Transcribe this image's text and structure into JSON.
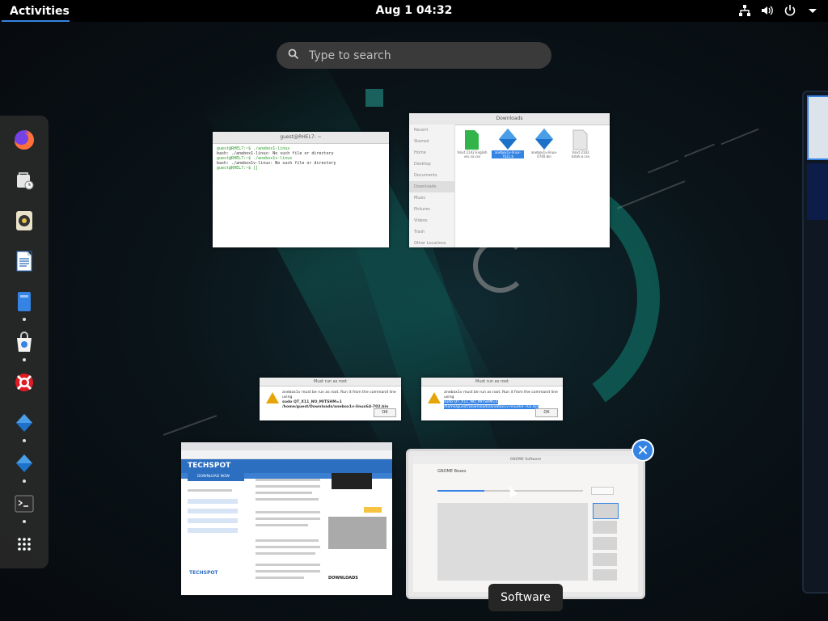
{
  "topbar": {
    "activities_label": "Activities",
    "clock": "Aug 1  04:32",
    "tray_icons": [
      "network-icon",
      "volume-icon",
      "power-icon",
      "chevron-down-icon"
    ]
  },
  "search": {
    "placeholder": "Type to search"
  },
  "dash": {
    "items": [
      {
        "name": "firefox",
        "icon": "firefox-icon",
        "running": false
      },
      {
        "name": "evolution",
        "icon": "evolution-icon",
        "running": false
      },
      {
        "name": "rhythmbox",
        "icon": "rhythmbox-icon",
        "running": false
      },
      {
        "name": "libreoffice-writer",
        "icon": "writer-icon",
        "running": false
      },
      {
        "name": "files",
        "icon": "files-icon",
        "running": true
      },
      {
        "name": "software",
        "icon": "software-icon",
        "running": true
      },
      {
        "name": "help",
        "icon": "help-icon",
        "running": false
      },
      {
        "name": "anbox-1",
        "icon": "diamond-app-icon",
        "running": true
      },
      {
        "name": "anbox-2",
        "icon": "diamond-app-icon",
        "running": true
      },
      {
        "name": "terminal",
        "icon": "terminal-icon",
        "running": true
      },
      {
        "name": "show-applications",
        "icon": "app-grid-icon",
        "running": false
      }
    ]
  },
  "windows": {
    "terminal": {
      "title": "guest@RHEL7: ~",
      "lines": [
        "guest@RHEL7:~$ ./anebox1-linux",
        "bash: ./anebox1-linux: No such file or directory",
        "guest@RHEL7:~$ ./anebox1v-linux",
        "bash: ./anebox1v-linux: No such file or directory",
        "guest@RHEL7:~$ []"
      ]
    },
    "files": {
      "title": "Downloads",
      "sidebar": [
        "Recent",
        "Starred",
        "Home",
        "Desktop",
        "Documents",
        "Downloads",
        "Music",
        "Pictures",
        "Videos",
        "Trash",
        "Other Locations"
      ],
      "files": [
        {
          "label": "Vsixt 2142 English voc.sa.csv",
          "color": "#33b44a"
        },
        {
          "label": "anebox1v-linux-7021.b",
          "color": "#1c72c9"
        },
        {
          "label": "anebox1v-linux-0740.bin",
          "color": "#1c72c9"
        },
        {
          "label": "Vsixt 2142 kstok.e.csv",
          "color": "#dcdcdc"
        }
      ]
    },
    "dialog1": {
      "title": "Must run as root",
      "message": "anebox1v must be run as root. Run it from the command line using",
      "command": "sudo QT_X11_NO_MITSHM=1 /home/guest/Downloads/anebox1v-linux64-702.bin",
      "ok": "OK"
    },
    "dialog2": {
      "title": "Must run as root",
      "message": "anebox1v must be run as root. Run it from the command line using",
      "command": "sudo QT_X11_NO_MITSHM=1 /home/guest/Downloads/anebox1v-linux64-702.bin",
      "ok": "OK"
    },
    "browser": {
      "site": "TECHSPOT",
      "button": "DOWNLOAD NOW",
      "downloads_heading": "DOWNLOADS",
      "footer_logo": "TECHSPOT"
    },
    "software": {
      "title": "GNOME Software",
      "app_name": "GNOME Boxes",
      "tooltip": "Software"
    }
  }
}
